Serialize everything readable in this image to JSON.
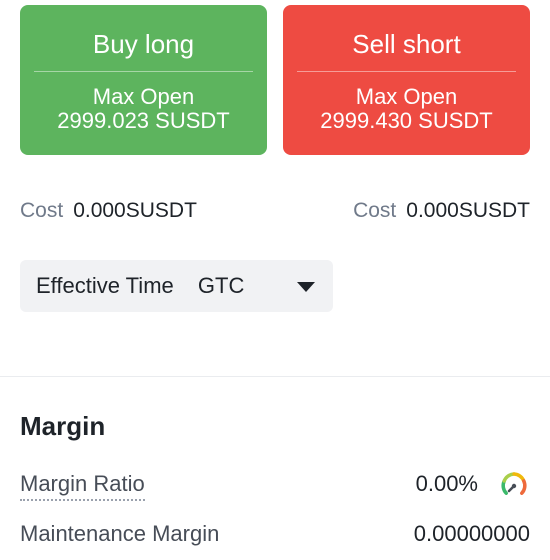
{
  "buy": {
    "title": "Buy long",
    "max_open_label": "Max Open",
    "max_open_value": "2999.023 SUSDT",
    "color": "#5db45e"
  },
  "sell": {
    "title": "Sell short",
    "max_open_label": "Max Open",
    "max_open_value": "2999.430 SUSDT",
    "color": "#ee4b42"
  },
  "cost": {
    "left_label": "Cost",
    "left_value": "0.000SUSDT",
    "right_label": "Cost",
    "right_value": "0.000SUSDT"
  },
  "effective_time": {
    "label": "Effective Time",
    "value": "GTC",
    "icon": "caret-down-icon"
  },
  "margin": {
    "heading": "Margin",
    "ratio_label": "Margin Ratio",
    "ratio_value": "0.00%",
    "ratio_icon": "gauge-icon",
    "maintenance_label": "Maintenance Margin",
    "maintenance_value": "0.00000000"
  }
}
